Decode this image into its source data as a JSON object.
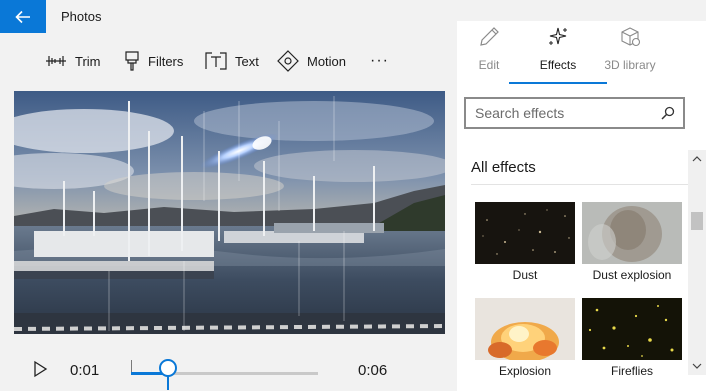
{
  "app": {
    "title": "Photos"
  },
  "toolbar": {
    "items": [
      {
        "label": "Trim",
        "icon": "trim-icon"
      },
      {
        "label": "Filters",
        "icon": "filters-icon"
      },
      {
        "label": "Text",
        "icon": "text-icon"
      },
      {
        "label": "Motion",
        "icon": "motion-icon"
      }
    ],
    "more": "···"
  },
  "playback": {
    "current_time": "0:01",
    "end_time": "0:06",
    "progress": 0.2
  },
  "panel": {
    "tabs": [
      {
        "label": "Edit",
        "icon": "pencil-icon",
        "active": false
      },
      {
        "label": "Effects",
        "icon": "sparkle-icon",
        "active": true
      },
      {
        "label": "3D library",
        "icon": "cube-icon",
        "active": false
      }
    ],
    "search": {
      "placeholder": "Search effects"
    },
    "section_title": "All effects",
    "effects": [
      {
        "label": "Dust"
      },
      {
        "label": "Dust explosion"
      },
      {
        "label": "Explosion"
      },
      {
        "label": "Fireflies"
      }
    ]
  },
  "colors": {
    "accent": "#0a78d7"
  }
}
